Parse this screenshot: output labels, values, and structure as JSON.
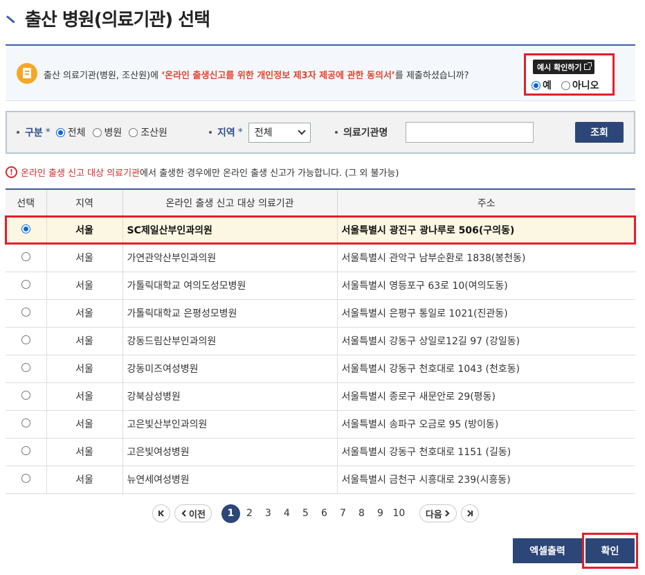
{
  "page": {
    "title": "출산 병원(의료기관) 선택"
  },
  "notice": {
    "text_before": "출산 의료기관(병원, 조산원)에 ",
    "highlight": "‘온라인 출생신고를 위한 개인정보 제3자 제공에 관한 동의서’",
    "text_after": "를 제출하셨습니까?",
    "icon": "document-icon",
    "example_button": "예시 확인하기",
    "option_yes": "예",
    "option_no": "아니오",
    "selected": "yes"
  },
  "filter": {
    "category_label": "구분",
    "category_options": [
      "전체",
      "병원",
      "조산원"
    ],
    "category_selected": "전체",
    "region_label": "지역",
    "region_value": "전체",
    "name_label": "의료기관명",
    "name_value": "",
    "required_mark": "*",
    "search_button": "조회"
  },
  "warning": {
    "highlight": "온라인 출생 신고 대상 의료기관",
    "text": "에서 출생한 경우에만 온라인 출생 신고가 가능합니다. (그 외 불가능)"
  },
  "table": {
    "headers": [
      "선택",
      "지역",
      "온라인 출생 신고 대상 의료기관",
      "주소"
    ],
    "selected_index": 0,
    "rows": [
      {
        "region": "서울",
        "name": "SC제일산부인과의원",
        "address": "서울특별시 광진구 광나루로 506(구의동)"
      },
      {
        "region": "서울",
        "name": "가연관악산부인과의원",
        "address": "서울특별시 관악구 남부순환로 1838(봉천동)"
      },
      {
        "region": "서울",
        "name": "가톨릭대학교 여의도성모병원",
        "address": "서울특별시 영등포구 63로 10(여의도동)"
      },
      {
        "region": "서울",
        "name": "가톨릭대학교 은평성모병원",
        "address": "서울특별시 은평구 통일로 1021(진관동)"
      },
      {
        "region": "서울",
        "name": "강동드림산부인과의원",
        "address": "서울특별시 강동구 상일로12길 97 (강일동)"
      },
      {
        "region": "서울",
        "name": "강동미즈여성병원",
        "address": "서울특별시 강동구 천호대로 1043 (천호동)"
      },
      {
        "region": "서울",
        "name": "강북삼성병원",
        "address": "서울특별시 종로구 새문안로 29(평동)"
      },
      {
        "region": "서울",
        "name": "고은빛산부인과의원",
        "address": "서울특별시 송파구 오금로 95 (방이동)"
      },
      {
        "region": "서울",
        "name": "고은빛여성병원",
        "address": "서울특별시 강동구 천호대로 1151 (길동)"
      },
      {
        "region": "서울",
        "name": "뉴연세여성병원",
        "address": "서울특별시 금천구 시흥대로 239(시흥동)"
      }
    ]
  },
  "pagination": {
    "prev_label": "이전",
    "next_label": "다음",
    "pages": [
      "1",
      "2",
      "3",
      "4",
      "5",
      "6",
      "7",
      "8",
      "9",
      "10"
    ],
    "current": "1"
  },
  "actions": {
    "excel_button": "엑셀출력",
    "confirm_button": "확인"
  },
  "colors": {
    "accent": "#2d4678",
    "highlight_red": "#e51c2a",
    "notice_highlight": "#e0452e"
  }
}
